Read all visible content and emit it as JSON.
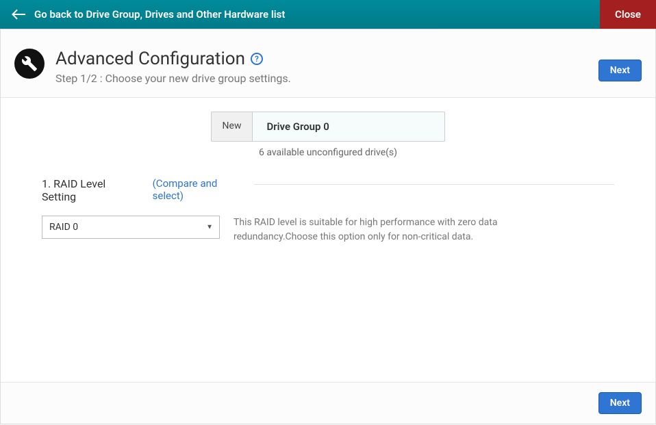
{
  "topbar": {
    "back_text": "Go back to Drive Group, Drives and Other Hardware list",
    "close_label": "Close"
  },
  "header": {
    "title": "Advanced Configuration",
    "subtitle": "Step 1/2 : Choose your new drive group settings.",
    "help_glyph": "?",
    "next_label": "Next"
  },
  "drive_group": {
    "new_label": "New",
    "name": "Drive Group 0",
    "available_text": "6 available unconfigured drive(s)"
  },
  "raid": {
    "section_label": "1. RAID Level Setting",
    "compare_link": "(Compare and select)",
    "selected": "RAID 0",
    "description": "This RAID level is suitable for high performance with zero data redundancy.Choose this option only for non-critical data."
  },
  "footer": {
    "next_label": "Next"
  }
}
